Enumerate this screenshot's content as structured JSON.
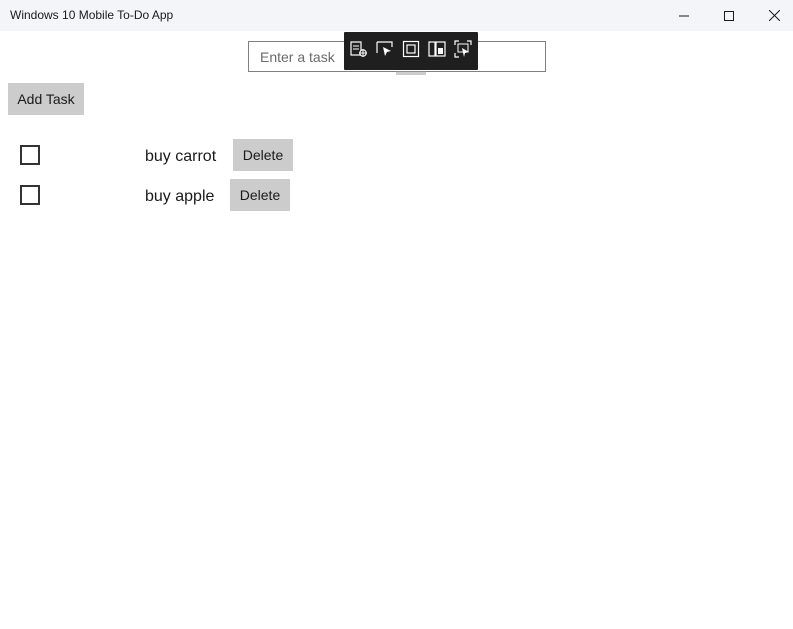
{
  "window": {
    "title": "Windows 10 Mobile To-Do App"
  },
  "task_input": {
    "placeholder": "Enter a task",
    "value": ""
  },
  "add_button": {
    "label": "Add Task"
  },
  "tasks": [
    {
      "text": "buy carrot",
      "checked": false,
      "delete_label": "Delete"
    },
    {
      "text": "buy apple",
      "checked": false,
      "delete_label": "Delete"
    }
  ],
  "debug_toolbar": {
    "icons": [
      "live-visual-tree-icon",
      "select-element-icon",
      "display-layout-adorners-icon",
      "track-focus-icon",
      "hot-reload-icon"
    ]
  },
  "colors": {
    "titlebar_bg": "#f3f5f9",
    "button_bg": "#cccccc",
    "toolbar_bg": "#1f1f1f"
  }
}
